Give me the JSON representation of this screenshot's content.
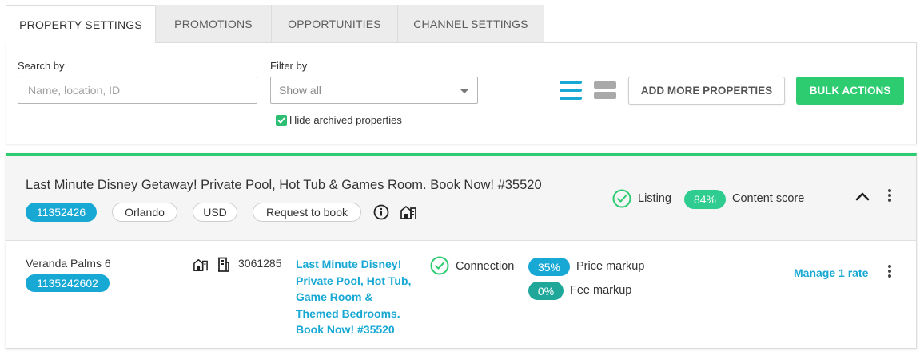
{
  "tabs": [
    {
      "label": "PROPERTY SETTINGS",
      "active": true
    },
    {
      "label": "PROMOTIONS",
      "active": false
    },
    {
      "label": "OPPORTUNITIES",
      "active": false
    },
    {
      "label": "CHANNEL SETTINGS",
      "active": false
    }
  ],
  "filters": {
    "search_label": "Search by",
    "search_placeholder": "Name, location, ID",
    "filter_label": "Filter by",
    "filter_value": "Show all",
    "hide_archived_label": "Hide archived properties",
    "hide_archived_checked": true
  },
  "toolbar": {
    "add_label": "ADD MORE PROPERTIES",
    "bulk_label": "BULK ACTIONS",
    "view_mode": "list"
  },
  "property": {
    "title": "Last Minute Disney Getaway! Private Pool, Hot Tub & Games Room. Book Now! #35520",
    "id": "11352426",
    "location": "Orlando",
    "currency": "USD",
    "booking_type": "Request to book",
    "listing_label": "Listing",
    "content_score": "84%",
    "content_score_label": "Content score",
    "unit": {
      "name": "Veranda Palms 6",
      "id": "1135242602",
      "channel_id": "3061285",
      "channel_title": [
        "Last Minute Disney!",
        "Private Pool, Hot Tub,",
        "Game Room &",
        "Themed Bedrooms.",
        "Book Now! #35520"
      ],
      "connection_label": "Connection",
      "price_markup": "35%",
      "price_markup_label": "Price markup",
      "fee_markup": "0%",
      "fee_markup_label": "Fee markup",
      "manage_label": "Manage 1 rate"
    }
  },
  "colors": {
    "accent_blue": "#17a8d4",
    "accent_green": "#2ecc71"
  }
}
